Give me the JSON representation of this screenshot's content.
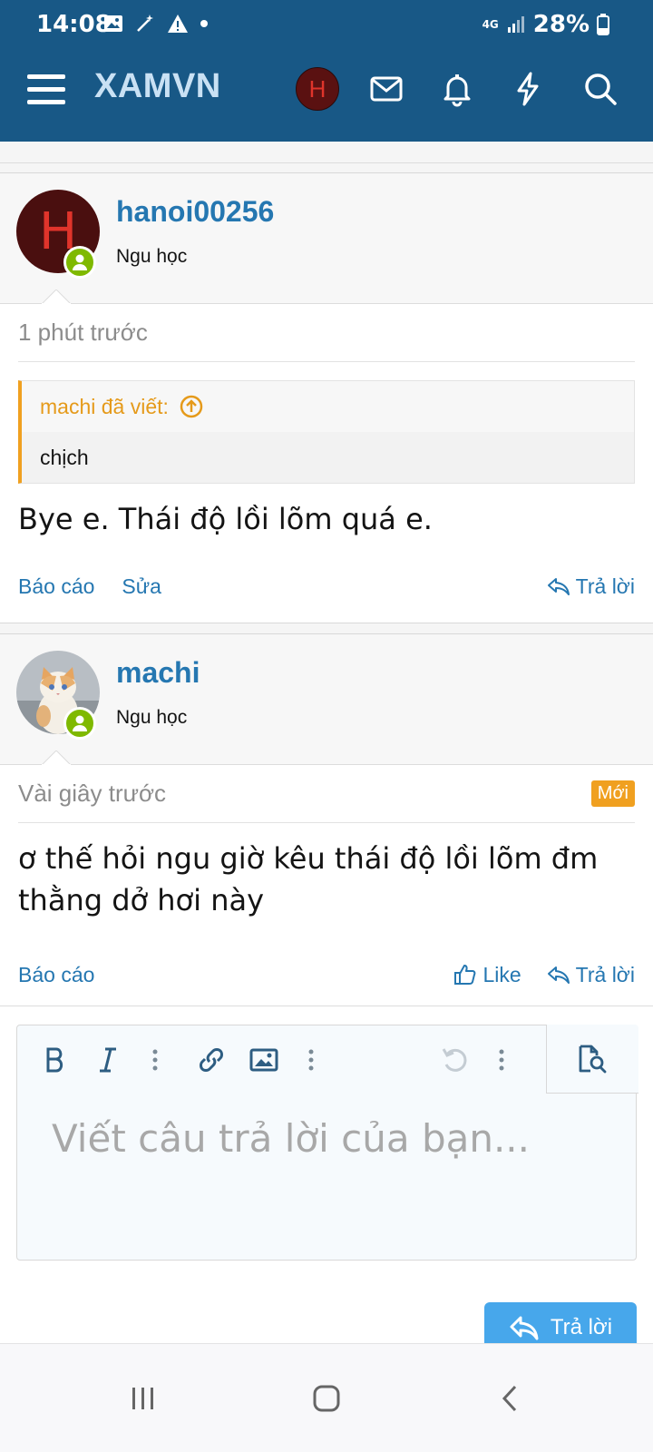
{
  "status_bar": {
    "time": "14:08",
    "network": "4G",
    "battery": "28%"
  },
  "header": {
    "brand": "XAMVN",
    "avatar_letter": "H"
  },
  "posts": [
    {
      "username": "hanoi00256",
      "user_title": "Ngu học",
      "avatar_letter": "H",
      "time": "1 phút trước",
      "quote": {
        "author": "machi đã viết:",
        "text": "chịch"
      },
      "message": "Bye e. Thái độ lồi lõm quá e.",
      "actions": {
        "report": "Báo cáo",
        "edit": "Sửa",
        "reply": "Trả lời"
      }
    },
    {
      "username": "machi",
      "user_title": "Ngu học",
      "time": "Vài giây trước",
      "badge": "Mới",
      "message": "ơ thế hỏi ngu giờ kêu thái độ lồi lõm đm thằng dở hơi này",
      "actions": {
        "report": "Báo cáo",
        "like": "Like",
        "reply": "Trả lời"
      }
    }
  ],
  "editor": {
    "placeholder": "Viết câu trả lời của bạn...",
    "submit": "Trả lời"
  },
  "colors": {
    "header_bg": "#185886",
    "link": "#2577b1",
    "accent": "#f0a020",
    "online": "#7fb900",
    "submit_bg": "#47a7eb"
  }
}
